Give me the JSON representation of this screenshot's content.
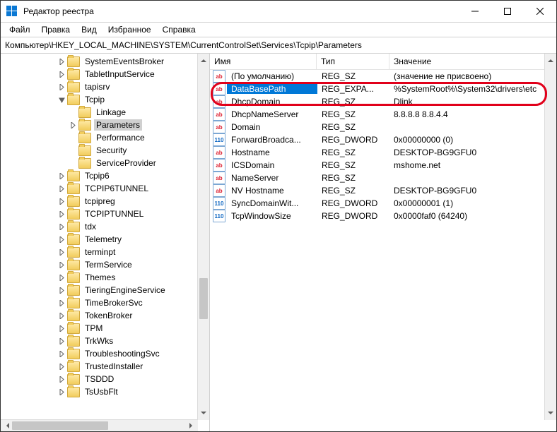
{
  "window": {
    "title": "Редактор реестра"
  },
  "menu": {
    "file": "Файл",
    "edit": "Правка",
    "view": "Вид",
    "favorites": "Избранное",
    "help": "Справка"
  },
  "path": "Компьютер\\HKEY_LOCAL_MACHINE\\SYSTEM\\CurrentControlSet\\Services\\Tcpip\\Parameters",
  "tree": [
    {
      "d": 5,
      "t": 0,
      "l": "SystemEventsBroker"
    },
    {
      "d": 5,
      "t": 0,
      "l": "TabletInputService"
    },
    {
      "d": 5,
      "t": 0,
      "l": "tapisrv"
    },
    {
      "d": 5,
      "t": 2,
      "l": "Tcpip"
    },
    {
      "d": 6,
      "t": -1,
      "l": "Linkage"
    },
    {
      "d": 6,
      "t": 0,
      "l": "Parameters",
      "sel": true
    },
    {
      "d": 6,
      "t": -1,
      "l": "Performance"
    },
    {
      "d": 6,
      "t": -1,
      "l": "Security"
    },
    {
      "d": 6,
      "t": -1,
      "l": "ServiceProvider"
    },
    {
      "d": 5,
      "t": 0,
      "l": "Tcpip6"
    },
    {
      "d": 5,
      "t": 0,
      "l": "TCPIP6TUNNEL"
    },
    {
      "d": 5,
      "t": 0,
      "l": "tcpipreg"
    },
    {
      "d": 5,
      "t": 0,
      "l": "TCPIPTUNNEL"
    },
    {
      "d": 5,
      "t": 0,
      "l": "tdx"
    },
    {
      "d": 5,
      "t": 0,
      "l": "Telemetry"
    },
    {
      "d": 5,
      "t": 0,
      "l": "terminpt"
    },
    {
      "d": 5,
      "t": 0,
      "l": "TermService"
    },
    {
      "d": 5,
      "t": 0,
      "l": "Themes"
    },
    {
      "d": 5,
      "t": 0,
      "l": "TieringEngineService"
    },
    {
      "d": 5,
      "t": 0,
      "l": "TimeBrokerSvc"
    },
    {
      "d": 5,
      "t": 0,
      "l": "TokenBroker"
    },
    {
      "d": 5,
      "t": 0,
      "l": "TPM"
    },
    {
      "d": 5,
      "t": 0,
      "l": "TrkWks"
    },
    {
      "d": 5,
      "t": 0,
      "l": "TroubleshootingSvc"
    },
    {
      "d": 5,
      "t": 0,
      "l": "TrustedInstaller"
    },
    {
      "d": 5,
      "t": 0,
      "l": "TSDDD"
    },
    {
      "d": 5,
      "t": 0,
      "l": "TsUsbFlt"
    }
  ],
  "columns": {
    "name": "Имя",
    "type": "Тип",
    "data": "Значение"
  },
  "values": [
    {
      "k": "str",
      "n": "(По умолчанию)",
      "t": "REG_SZ",
      "d": "(значение не присвоено)"
    },
    {
      "k": "str",
      "n": "DataBasePath",
      "t": "REG_EXPA...",
      "d": "%SystemRoot%\\System32\\drivers\\etc",
      "sel": true
    },
    {
      "k": "str",
      "n": "DhcpDomain",
      "t": "REG_SZ",
      "d": "Dlink"
    },
    {
      "k": "str",
      "n": "DhcpNameServer",
      "t": "REG_SZ",
      "d": "8.8.8.8 8.8.4.4"
    },
    {
      "k": "str",
      "n": "Domain",
      "t": "REG_SZ",
      "d": ""
    },
    {
      "k": "bin",
      "n": "ForwardBroadca...",
      "t": "REG_DWORD",
      "d": "0x00000000 (0)"
    },
    {
      "k": "str",
      "n": "Hostname",
      "t": "REG_SZ",
      "d": "DESKTOP-BG9GFU0"
    },
    {
      "k": "str",
      "n": "ICSDomain",
      "t": "REG_SZ",
      "d": "mshome.net"
    },
    {
      "k": "str",
      "n": "NameServer",
      "t": "REG_SZ",
      "d": ""
    },
    {
      "k": "str",
      "n": "NV Hostname",
      "t": "REG_SZ",
      "d": "DESKTOP-BG9GFU0"
    },
    {
      "k": "bin",
      "n": "SyncDomainWit...",
      "t": "REG_DWORD",
      "d": "0x00000001 (1)"
    },
    {
      "k": "bin",
      "n": "TcpWindowSize",
      "t": "REG_DWORD",
      "d": "0x0000faf0 (64240)"
    }
  ],
  "iconGlyph": {
    "str": "ab",
    "bin": "110"
  }
}
